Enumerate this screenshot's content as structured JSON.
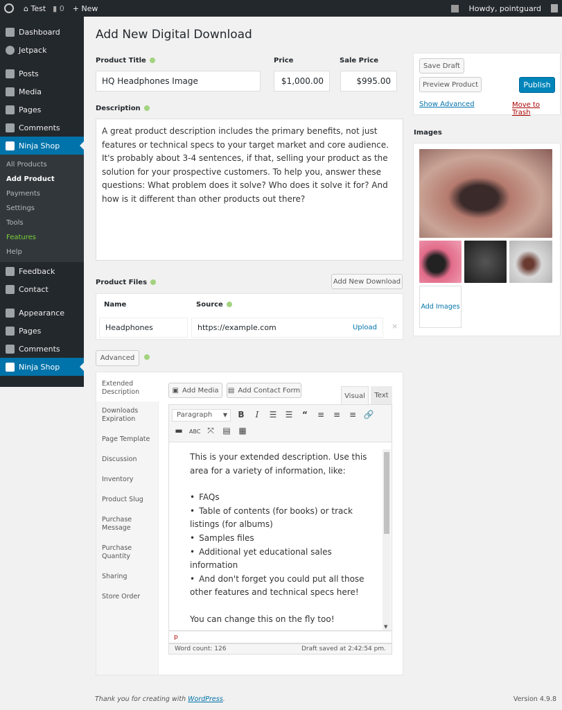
{
  "topbar": {
    "site": "Test",
    "comments": "0",
    "new": "New",
    "howdy": "Howdy, pointguard"
  },
  "sidebar": {
    "items": [
      "Dashboard",
      "Jetpack",
      "Posts",
      "Media",
      "Pages",
      "Comments",
      "Ninja Shop"
    ],
    "sub": [
      "All Products",
      "Add Product",
      "Payments",
      "Settings",
      "Tools",
      "Features",
      "Help"
    ],
    "after": [
      "Feedback",
      "Contact",
      "Appearance",
      "Pages",
      "Comments",
      "Ninja Shop"
    ]
  },
  "page": {
    "title": "Add New Digital Download"
  },
  "form": {
    "product_title_label": "Product Title",
    "product_title": "HQ Headphones Image",
    "price_label": "Price",
    "price": "$1,000.00",
    "sale_label": "Sale Price",
    "sale": "$995.00",
    "desc_label": "Description",
    "description": "A great product description includes the primary benefits, not just features or technical specs to your target market and core audience. It's probably about 3-4 sentences, if that, selling your product as the solution for your prospective customers. To help you, answer these questions: What problem does it solve? Who does it solve it for? And how is it different than other products out there?"
  },
  "files": {
    "label": "Product Files",
    "add": "Add New Download",
    "col_name": "Name",
    "col_source": "Source",
    "name": "Headphones",
    "source": "https://example.com",
    "upload": "Upload",
    "remove": "×"
  },
  "advanced": {
    "button": "Advanced",
    "tabs": [
      "Extended Description",
      "Downloads Expiration",
      "Page Template",
      "Discussion",
      "Inventory",
      "Product Slug",
      "Purchase Message",
      "Purchase Quantity",
      "Sharing",
      "Store Order"
    ]
  },
  "editor": {
    "add_media": "Add Media",
    "add_form": "Add Contact Form",
    "visual": "Visual",
    "text": "Text",
    "format": "Paragraph",
    "intro": "This is your extended description. Use this area for a variety of information, like:",
    "list": [
      "FAQs",
      "Table of contents (for books) or track listings (for albums)",
      "Samples files",
      "Additional yet educational sales information",
      "And don't forget you could put all those other features and technical specs here!"
    ],
    "outro": "You can change this on the fly too!",
    "path": "p",
    "word_count": "Word count: 126",
    "saved": "Draft saved at 2:42:54 pm."
  },
  "publish": {
    "save_draft": "Save Draft",
    "preview": "Preview Product",
    "publish": "Publish",
    "show_advanced": "Show Advanced",
    "trash": "Move to Trash"
  },
  "images": {
    "label": "Images",
    "add": "Add Images"
  },
  "footer": {
    "thanks": "Thank you for creating with ",
    "wp": "WordPress",
    "period": ".",
    "version": "Version 4.9.8"
  },
  "colors": {
    "accent": "#0073aa",
    "admin_bar": "#23282d",
    "trash": "#a00",
    "features": "#7ad03a"
  }
}
